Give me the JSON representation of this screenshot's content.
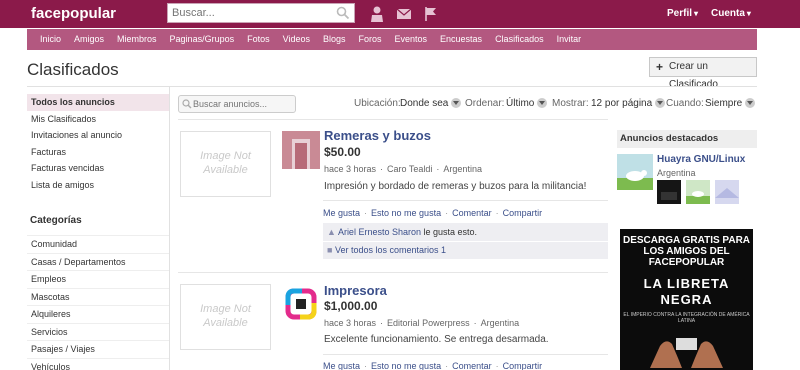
{
  "header": {
    "logo": "facepopular",
    "search_placeholder": "Buscar...",
    "perfil_label": "Perfil",
    "cuenta_label": "Cuenta"
  },
  "menu": [
    "Inicio",
    "Amigos",
    "Miembros",
    "Paginas/Grupos",
    "Fotos",
    "Videos",
    "Blogs",
    "Foros",
    "Eventos",
    "Encuestas",
    "Clasificados",
    "Invitar"
  ],
  "page": {
    "title": "Clasificados",
    "create_button": "Crear un Clasificado"
  },
  "sidebar": {
    "items": [
      "Todos los anuncios",
      "Mis Clasificados",
      "Invitaciones al anuncio",
      "Facturas",
      "Facturas vencidas",
      "Lista de amigos"
    ],
    "categories_title": "Categorías",
    "categories": [
      "Comunidad",
      "Casas / Departamentos",
      "Empleos",
      "Mascotas",
      "Alquileres",
      "Servicios",
      "Pasajes / Viajes",
      "Vehículos"
    ]
  },
  "filters": {
    "search_placeholder": "Buscar anuncios...",
    "ubicacion_label": "Ubicación:",
    "ubicacion_value": "Donde sea",
    "ordenar_label": "Ordenar:",
    "ordenar_value": "Último",
    "mostrar_label": "Mostrar:",
    "mostrar_value": "12 por página",
    "cuando_label": "Cuando:",
    "cuando_value": "Siempre"
  },
  "listings": [
    {
      "image_placeholder": "Image Not Available",
      "title": "Remeras y buzos",
      "price": "$50.00",
      "time": "hace 3 horas",
      "author": "Caro Tealdi",
      "country": "Argentina",
      "description": "Impresión y bordado de remeras y buzos para la militancia!",
      "actions": [
        "Me gusta",
        "Esto no me gusta",
        "Comentar",
        "Compartir"
      ],
      "liked_by": "Ariel Ernesto Sharon",
      "liked_suffix": "le gusta esto.",
      "comments_link": "Ver todos los comentarios 1"
    },
    {
      "image_placeholder": "Image Not Available",
      "title": "Impresora",
      "price": "$1,000.00",
      "time": "hace 3 horas",
      "author": "Editorial Powerpress",
      "country": "Argentina",
      "description": "Excelente funcionamiento. Se entrega desarmada.",
      "actions": [
        "Me gusta",
        "Esto no me gusta",
        "Comentar",
        "Compartir"
      ]
    }
  ],
  "featured": {
    "title": "Anuncios destacados",
    "ad_title": "Huayra GNU/Linux",
    "ad_location": "Argentina",
    "banner_line1": "DESCARGA GRATIS PARA LOS AMIGOS DEL FACEPOPULAR",
    "banner_line2": "LA LIBRETA NEGRA",
    "banner_line3": "EL IMPERIO CONTRA LA INTEGRACIÓN DE AMÉRICA LATINA"
  },
  "colors": {
    "topbar": "#8b1a4a",
    "menubar": "#b35880",
    "link": "#3b4f8a"
  }
}
